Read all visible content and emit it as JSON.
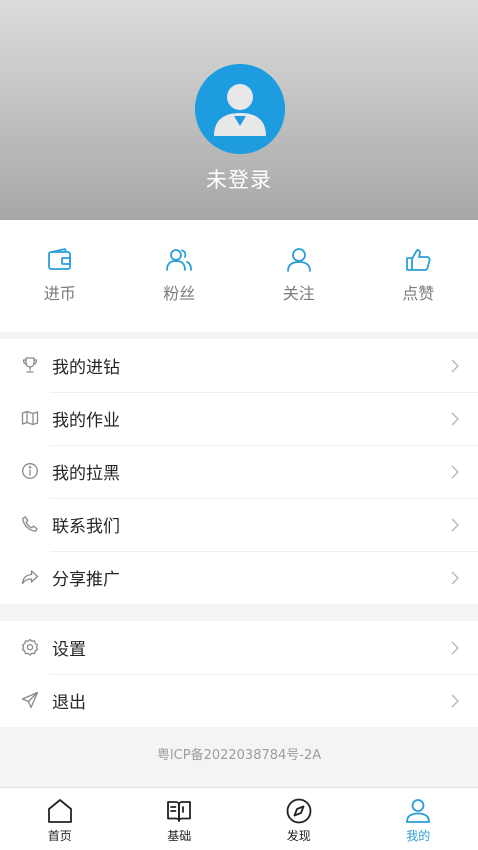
{
  "profile": {
    "login_status": "未登录",
    "avatar_color": "#1d9de0"
  },
  "stats": [
    {
      "label": "进币",
      "icon": "wallet-icon"
    },
    {
      "label": "粉丝",
      "icon": "fans-icon"
    },
    {
      "label": "关注",
      "icon": "follow-icon"
    },
    {
      "label": "点赞",
      "icon": "thumbs-up-icon"
    }
  ],
  "menu_primary": [
    {
      "label": "我的进钻",
      "icon": "trophy-icon"
    },
    {
      "label": "我的作业",
      "icon": "map-icon"
    },
    {
      "label": "我的拉黑",
      "icon": "info-icon"
    },
    {
      "label": "联系我们",
      "icon": "phone-icon"
    },
    {
      "label": "分享推广",
      "icon": "share-icon"
    }
  ],
  "menu_secondary": [
    {
      "label": "设置",
      "icon": "gear-icon"
    },
    {
      "label": "退出",
      "icon": "send-icon"
    }
  ],
  "footer": {
    "icp": "粤ICP备2022038784号-2A"
  },
  "tabbar": [
    {
      "label": "首页",
      "icon": "home-icon"
    },
    {
      "label": "基础",
      "icon": "book-icon"
    },
    {
      "label": "发现",
      "icon": "compass-icon"
    },
    {
      "label": "我的",
      "icon": "user-icon",
      "active": true
    }
  ],
  "colors": {
    "accent": "#2a9ed8",
    "text": "#262626",
    "muted": "#7b7b7b"
  }
}
